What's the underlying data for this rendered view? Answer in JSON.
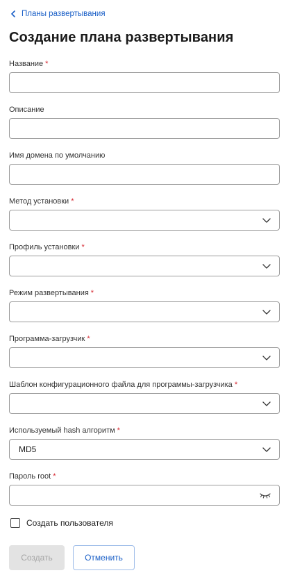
{
  "breadcrumb": {
    "label": "Планы развертывания"
  },
  "page": {
    "title": "Создание плана развертывания"
  },
  "form": {
    "name": {
      "label": "Название",
      "required_mark": "*",
      "value": ""
    },
    "description": {
      "label": "Описание",
      "value": ""
    },
    "domain": {
      "label": "Имя домена по умолчанию",
      "value": ""
    },
    "install_method": {
      "label": "Метод установки",
      "required_mark": "*",
      "value": ""
    },
    "install_profile": {
      "label": "Профиль установки",
      "required_mark": "*",
      "value": ""
    },
    "deploy_mode": {
      "label": "Режим развертывания",
      "required_mark": "*",
      "value": ""
    },
    "bootloader": {
      "label": "Программа-загрузчик",
      "required_mark": "*",
      "value": ""
    },
    "bootloader_template": {
      "label": "Шаблон конфигурационного файла для программы-загрузчика",
      "required_mark": "*",
      "value": ""
    },
    "hash_algorithm": {
      "label": "Используемый hash алгоритм",
      "required_mark": "*",
      "value": "MD5"
    },
    "root_password": {
      "label": "Пароль root",
      "required_mark": "*",
      "value": ""
    },
    "create_user": {
      "label": "Создать пользователя",
      "checked": false
    }
  },
  "actions": {
    "create_label": "Создать",
    "cancel_label": "Отменить"
  },
  "colors": {
    "link": "#1a5fc7",
    "required": "#d6262f",
    "border": "#9a9a9a",
    "disabled_bg": "#e3e3e3"
  },
  "icons": {
    "back": "chevron-left-icon",
    "select": "chevron-down-icon",
    "password": "eye-closed-icon"
  }
}
